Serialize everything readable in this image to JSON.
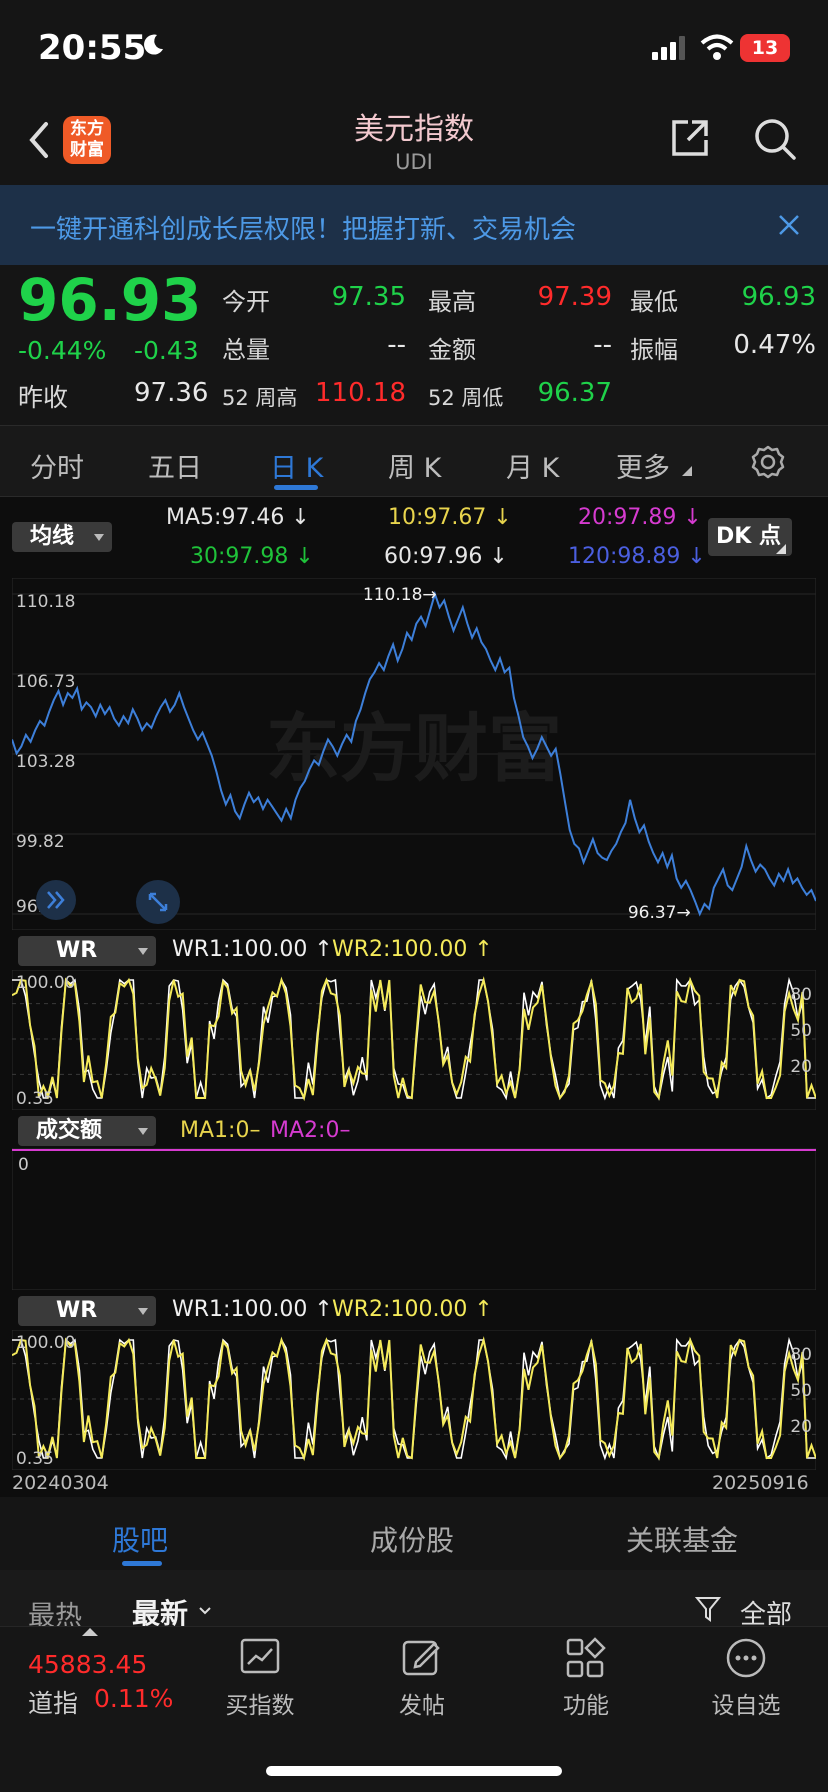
{
  "status_bar": {
    "time": "20:55",
    "battery": "13"
  },
  "header": {
    "logo_text": "东方财富",
    "title": "美元指数",
    "subtitle": "UDI"
  },
  "banner": {
    "text": "一键开通科创成长层权限！把握打新、交易机会"
  },
  "quote": {
    "price": "96.93",
    "change_pct": "-0.44%",
    "change": "-0.43",
    "prev_close_label": "昨收",
    "prev_close": "97.36",
    "open_label": "今开",
    "open": "97.35",
    "high_label": "最高",
    "high": "97.39",
    "low_label": "最低",
    "low": "96.93",
    "volume_label": "总量",
    "volume": "--",
    "amount_label": "金额",
    "amount": "--",
    "amplitude_label": "振幅",
    "amplitude": "0.47%",
    "week52_high_label": "52 周高",
    "week52_high": "110.18",
    "week52_low_label": "52 周低",
    "week52_low": "96.37"
  },
  "tabs": [
    "分时",
    "五日",
    "日 K",
    "周 K",
    "月 K",
    "更多"
  ],
  "active_tab": "日 K",
  "ma_panel": {
    "selector": "均线",
    "ma5": "MA5:97.46 ↓",
    "ma10": "10:97.67 ↓",
    "ma20": "20:97.89 ↓",
    "ma30": "30:97.98 ↓",
    "ma60": "60:97.96 ↓",
    "ma120": "120:98.89 ↓",
    "dk_button": "DK 点"
  },
  "wr_panel_1": {
    "selector": "WR",
    "wr1": "WR1:100.00 ↑",
    "wr2": "WR2:100.00 ↑"
  },
  "volume_panel": {
    "selector": "成交额",
    "ma1": "MA1:0–",
    "ma2": "MA2:0–",
    "zero": "0"
  },
  "wr_panel_2": {
    "selector": "WR",
    "wr1": "WR1:100.00 ↑",
    "wr2": "WR2:100.00 ↑"
  },
  "date_start": "20240304",
  "date_end": "20250916",
  "colors": {
    "up": "#ff2b2b",
    "down": "#1fd24a",
    "accent": "#2e78d6",
    "line": "#3d7fd9",
    "wr1": "#ffffff",
    "wr2": "#f4ea5a",
    "ma10": "#e8d44d",
    "ma20": "#d63bd0",
    "ma30": "#1fc23a",
    "ma120": "#4b5fe0"
  },
  "chart_data": [
    {
      "type": "line",
      "title": "",
      "yticks": [
        "110.18",
        "106.73",
        "103.28",
        "99.82",
        "96.37"
      ],
      "ylim": [
        96.37,
        110.18
      ],
      "max_label": "110.18",
      "min_label": "96.37",
      "watermark": "东方财富",
      "x_start": "20240304",
      "x_end": "20250916",
      "values": [
        103.9,
        103.3,
        103.6,
        104.1,
        103.8,
        104.3,
        104.7,
        104.5,
        105.1,
        105.6,
        106.0,
        105.4,
        105.9,
        105.7,
        106.1,
        105.2,
        105.5,
        105.3,
        104.9,
        105.4,
        105.0,
        105.3,
        104.8,
        104.5,
        104.9,
        104.6,
        105.2,
        104.8,
        104.3,
        104.6,
        104.4,
        104.9,
        105.3,
        105.6,
        105.1,
        105.4,
        105.9,
        105.3,
        104.8,
        104.3,
        103.9,
        104.2,
        103.7,
        103.2,
        102.5,
        101.7,
        101.1,
        101.5,
        100.8,
        100.5,
        101.1,
        101.6,
        101.2,
        101.4,
        100.9,
        101.3,
        101.0,
        100.7,
        100.4,
        100.9,
        100.5,
        101.3,
        101.8,
        102.1,
        102.6,
        103.0,
        102.8,
        103.4,
        103.9,
        103.6,
        103.2,
        103.7,
        104.1,
        103.8,
        104.7,
        105.2,
        105.9,
        106.5,
        106.8,
        107.2,
        106.9,
        107.5,
        108.0,
        107.3,
        107.8,
        108.5,
        108.2,
        108.9,
        109.2,
        108.8,
        109.5,
        110.18,
        109.6,
        109.9,
        109.2,
        108.6,
        109.1,
        109.6,
        108.9,
        108.3,
        108.7,
        108.1,
        107.8,
        107.3,
        106.9,
        107.4,
        106.8,
        107.0,
        105.7,
        104.9,
        104.0,
        103.6,
        103.1,
        103.5,
        104.0,
        103.6,
        103.2,
        103.5,
        102.4,
        101.2,
        100.0,
        99.4,
        99.2,
        98.6,
        99.1,
        99.6,
        99.0,
        98.8,
        98.7,
        99.1,
        99.4,
        99.9,
        100.3,
        101.3,
        100.5,
        99.9,
        100.2,
        99.5,
        99.0,
        98.6,
        99.0,
        98.4,
        98.9,
        97.9,
        97.5,
        97.8,
        97.4,
        96.9,
        96.37,
        96.8,
        96.6,
        97.5,
        97.9,
        98.3,
        97.6,
        97.4,
        97.9,
        98.4,
        99.3,
        98.7,
        98.2,
        98.5,
        98.3,
        97.9,
        97.6,
        98.1,
        97.8,
        98.3,
        97.7,
        97.9,
        97.5,
        97.2,
        97.4,
        96.93
      ]
    },
    {
      "type": "line",
      "title": "WR",
      "yticks": [
        "100.00",
        "80",
        "50",
        "20",
        "0.35"
      ],
      "ylim": [
        0,
        100
      ],
      "series": [
        {
          "name": "WR1"
        },
        {
          "name": "WR2"
        }
      ],
      "x_start": "20240304",
      "x_end": "20250916"
    },
    {
      "type": "line",
      "title": "成交额",
      "yticks": [
        "0"
      ],
      "series": [
        {
          "name": "MA1"
        },
        {
          "name": "MA2"
        }
      ]
    },
    {
      "type": "line",
      "title": "WR",
      "yticks": [
        "100.00",
        "80",
        "50",
        "20",
        "0.35"
      ],
      "ylim": [
        0,
        100
      ],
      "series": [
        {
          "name": "WR1"
        },
        {
          "name": "WR2"
        }
      ]
    }
  ],
  "guba_tabs": [
    "股吧",
    "成份股",
    "关联基金"
  ],
  "sort": {
    "hot": "最热",
    "latest": "最新",
    "filter": "全部"
  },
  "ticker": {
    "value": "45883.45",
    "name": "道指",
    "pct": "0.11%"
  },
  "toolbar": [
    {
      "label": "买指数",
      "icon": "chart-icon"
    },
    {
      "label": "发帖",
      "icon": "edit-icon"
    },
    {
      "label": "功能",
      "icon": "grid-icon"
    },
    {
      "label": "设自选",
      "icon": "more-icon"
    }
  ]
}
